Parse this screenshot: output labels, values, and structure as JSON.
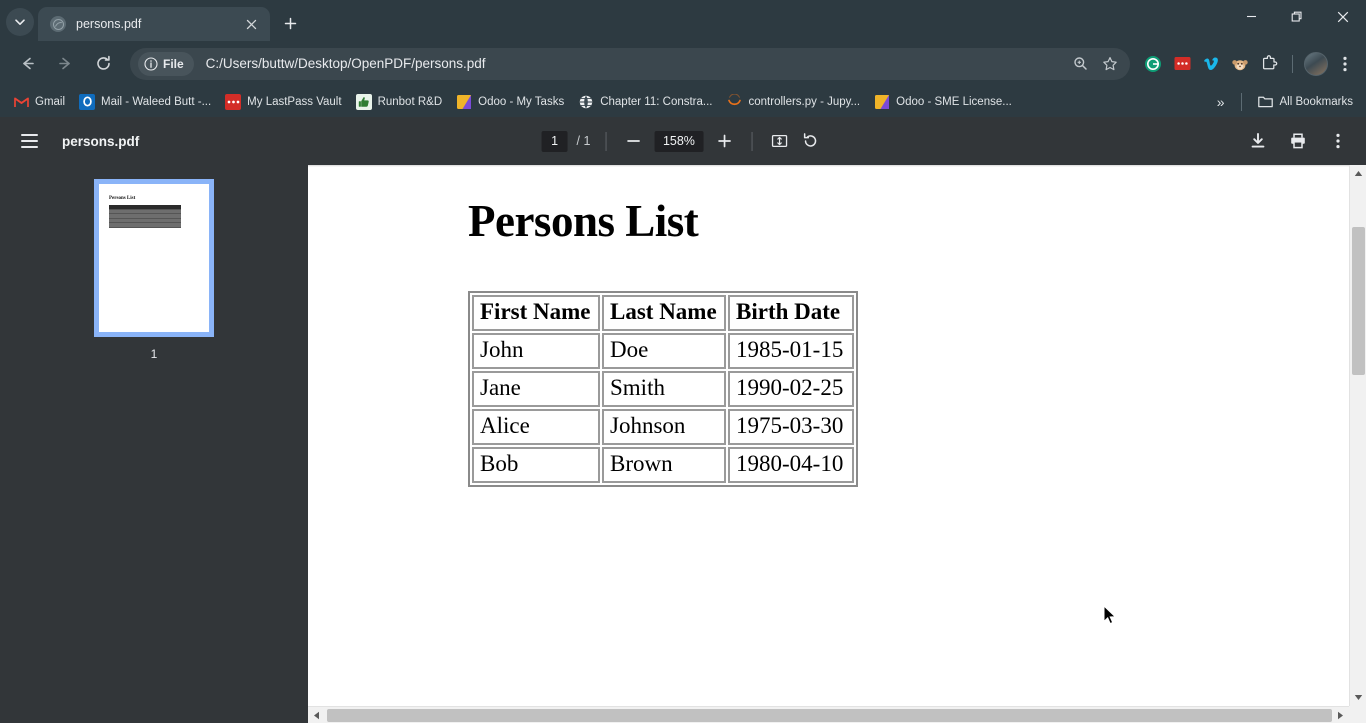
{
  "window": {
    "minimize_label": "Minimize",
    "restore_label": "Restore",
    "close_label": "Close"
  },
  "tabstrip": {
    "tab_search_name": "Search tabs",
    "tabs": [
      {
        "title": "persons.pdf",
        "favicon": "pdf-icon",
        "active": true
      }
    ],
    "new_tab_label": "New Tab"
  },
  "toolbar": {
    "back_label": "Back",
    "forward_label": "Forward",
    "reload_label": "Reload",
    "file_chip_label": "File",
    "url": "C:/Users/buttw/Desktop/OpenPDF/persons.pdf",
    "search_in_page_label": "Search",
    "bookmark_label": "Bookmark this tab",
    "extensions": [
      {
        "name": "grammarly-extension",
        "glyph": "G",
        "color": "#15c39a",
        "bg": "#ffffff"
      },
      {
        "name": "lastpass-extension",
        "glyph": "•••",
        "color": "#ffffff",
        "bg": "#d32d27"
      },
      {
        "name": "vimeo-extension",
        "glyph": "V",
        "color": "#1ab7ea",
        "bg": "transparent"
      },
      {
        "name": "honey-extension",
        "glyph": "🐵",
        "color": "#e0a45e",
        "bg": "transparent"
      },
      {
        "name": "extensions-puzzle-icon",
        "glyph": "",
        "color": "#e8eaed",
        "bg": "transparent"
      }
    ],
    "profile_label": "Profile",
    "menu_label": "Customize and control Google Chrome"
  },
  "bookmarks": {
    "items": [
      {
        "label": "Gmail",
        "icon": "gmail-icon",
        "glyph": "M",
        "color": "#ea4335",
        "bg": "transparent"
      },
      {
        "label": "Mail - Waleed Butt -...",
        "icon": "outlook-icon",
        "glyph": "O",
        "color": "#ffffff",
        "bg": "#0f6cbd"
      },
      {
        "label": "My LastPass Vault",
        "icon": "lastpass-icon",
        "glyph": "•••",
        "color": "#ffffff",
        "bg": "#d32d27"
      },
      {
        "label": "Runbot R&D",
        "icon": "thumbsup-icon",
        "glyph": "👍",
        "color": "#2f7d32",
        "bg": "#e9f3ea"
      },
      {
        "label": "Odoo - My Tasks",
        "icon": "odoo-icon",
        "glyph": "▨",
        "color": "#ffffff",
        "bg": "linear-gradient(135deg,#f0b429 0%,#f0b429 45%,#7b4bd8 46%,#7b4bd8 100%)"
      },
      {
        "label": "Chapter 11: Constra...",
        "icon": "globe-icon",
        "glyph": "🌐",
        "color": "#ffffff",
        "bg": "transparent"
      },
      {
        "label": "controllers.py - Jupy...",
        "icon": "jupyter-icon",
        "glyph": "◡",
        "color": "#e8711a",
        "bg": "transparent"
      },
      {
        "label": "Odoo - SME License...",
        "icon": "odoo-icon",
        "glyph": "▨",
        "color": "#ffffff",
        "bg": "linear-gradient(135deg,#f0b429 0%,#f0b429 45%,#7b4bd8 46%,#7b4bd8 100%)"
      }
    ],
    "overflow_label": "»",
    "all_bookmarks_label": "All Bookmarks"
  },
  "pdf_viewer": {
    "sidebar_toggle_label": "Toggle sidebar",
    "filename": "persons.pdf",
    "page_current": "1",
    "page_total": "/ 1",
    "zoom_out_label": "Zoom out",
    "zoom_level": "158%",
    "zoom_in_label": "Zoom in",
    "fit_label": "Fit to page",
    "rotate_label": "Rotate counterclockwise",
    "download_label": "Download",
    "print_label": "Print",
    "more_label": "More actions",
    "thumbnail_page_number": "1",
    "thumbnail_title": "Persons List"
  },
  "document": {
    "title": "Persons List",
    "table": {
      "headers": [
        "First Name",
        "Last Name",
        "Birth Date"
      ],
      "rows": [
        [
          "John",
          "Doe",
          "1985-01-15"
        ],
        [
          "Jane",
          "Smith",
          "1990-02-25"
        ],
        [
          "Alice",
          "Johnson",
          "1975-03-30"
        ],
        [
          "Bob",
          "Brown",
          "1980-04-10"
        ]
      ]
    }
  },
  "scrollbars": {
    "vertical_name": "vertical-scrollbar",
    "horizontal_name": "horizontal-scrollbar"
  },
  "colors": {
    "chrome_bg": "#2d3a41",
    "tab_active": "#3c4a52",
    "pdf_toolbar": "#323639",
    "accent_blue": "#8ab4f8",
    "page_white": "#ffffff"
  }
}
